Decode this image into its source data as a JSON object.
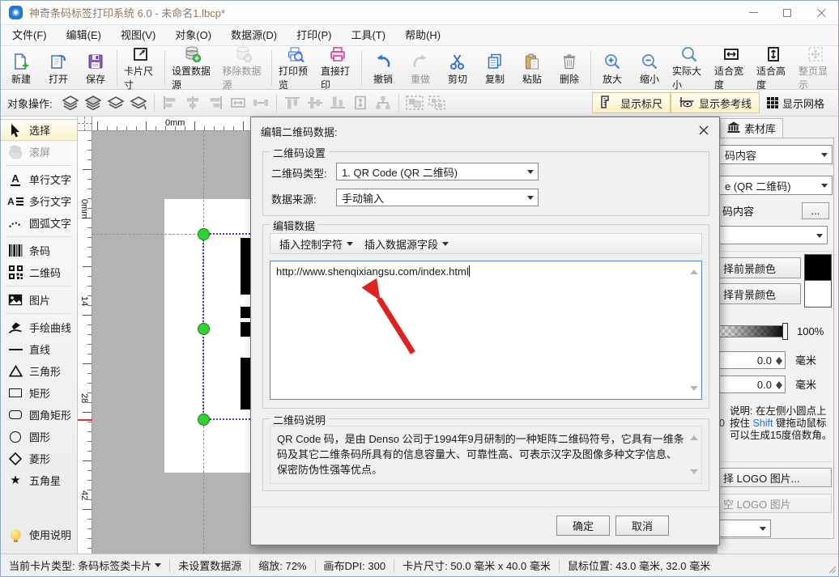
{
  "window": {
    "title": "神奇条码标签打印系统 6.0 - 未命名1.lbcp*"
  },
  "menu": {
    "items": [
      "文件(F)",
      "编辑(E)",
      "视图(V)",
      "对象(O)",
      "数据源(D)",
      "打印(P)",
      "工具(T)",
      "帮助(H)"
    ]
  },
  "toolbar": {
    "labels": [
      "新建",
      "打开",
      "保存",
      "卡片尺寸",
      "设置数据源",
      "移除数据源",
      "打印预览",
      "直接打印",
      "撤销",
      "重做",
      "剪切",
      "复制",
      "粘贴",
      "删除",
      "放大",
      "缩小",
      "实际大小",
      "适合宽度",
      "适合高度",
      "整页显示"
    ]
  },
  "object_toolbar": {
    "label": "对象操作:",
    "show_ruler": "显示标尺",
    "show_guides": "显示参考线",
    "show_grid": "显示网格"
  },
  "sidebar": {
    "tools": [
      "选择",
      "滚屏",
      "单行文字",
      "多行文字",
      "圆弧文字",
      "条码",
      "二维码",
      "图片",
      "手绘曲线",
      "直线",
      "三角形",
      "矩形",
      "圆角矩形",
      "圆形",
      "菱形",
      "五角星"
    ],
    "help": "使用说明"
  },
  "canvas": {
    "ruler_h_zero": "0mm",
    "ruler_v_zero": "0mm",
    "ruler_v_ticks": [
      "14",
      "28",
      "42"
    ]
  },
  "dialog": {
    "title": "编辑二维码数据:",
    "settings_group": "二维码设置",
    "type_label": "二维码类型:",
    "type_value": "1. QR Code (QR 二维码)",
    "source_label": "数据来源:",
    "source_value": "手动输入",
    "edit_group": "编辑数据",
    "insert_control": "插入控制字符",
    "insert_field": "插入数据源字段",
    "data_value": "http://www.shenqixiangsu.com/index.html",
    "desc_group": "二维码说明",
    "desc_text": "QR Code 码，是由 Denso 公司于1994年9月研制的一种矩阵二维码符号，它具有一维条码及其它二维条码所具有的信息容量大、可靠性高、可表示汉字及图像多种文字信息、保密防伪性强等优点。",
    "ok": "确定",
    "cancel": "取消"
  },
  "right_panel": {
    "tab": "素材库",
    "combo1": "码内容",
    "combo2": "e (QR 二维码)",
    "content_label": "码内容",
    "more_button": "...",
    "fg_button": "择前景颜色",
    "bg_button": "择背景颜色",
    "opacity": "100%",
    "spin1": "0.0",
    "spin2": "0.0",
    "unit1": "毫米",
    "unit2": "毫米",
    "partial_zero": "0",
    "note_prefix": "说明: 在左侧小圆点上按住 ",
    "note_shift": "Shift",
    "note_suffix": " 键拖动鼠标可以生成15度倍数角。",
    "logo_select": "择 LOGO 图片...",
    "logo_clear": "空 LOGO 图片"
  },
  "status_bar": {
    "card_type": "当前卡片类型: 条码标签类卡片",
    "datasource": "未设置数据源",
    "zoom": "缩放: 72%",
    "dpi": "画布DPI: 300",
    "card_size": "卡片尺寸: 50.0 毫米 x 40.0 毫米",
    "mouse": "鼠标位置: 43.0 毫米, 32.0 毫米"
  },
  "colors": {
    "save_purple": "#8a5fb8",
    "print_pink": "#d4368f",
    "action_blue": "#3a6fd8",
    "handle_green": "#2fd32f",
    "guide_blue": "#8585f0",
    "arrow_red": "#dd2222",
    "toggle_yellow": "#fbf0c6"
  }
}
